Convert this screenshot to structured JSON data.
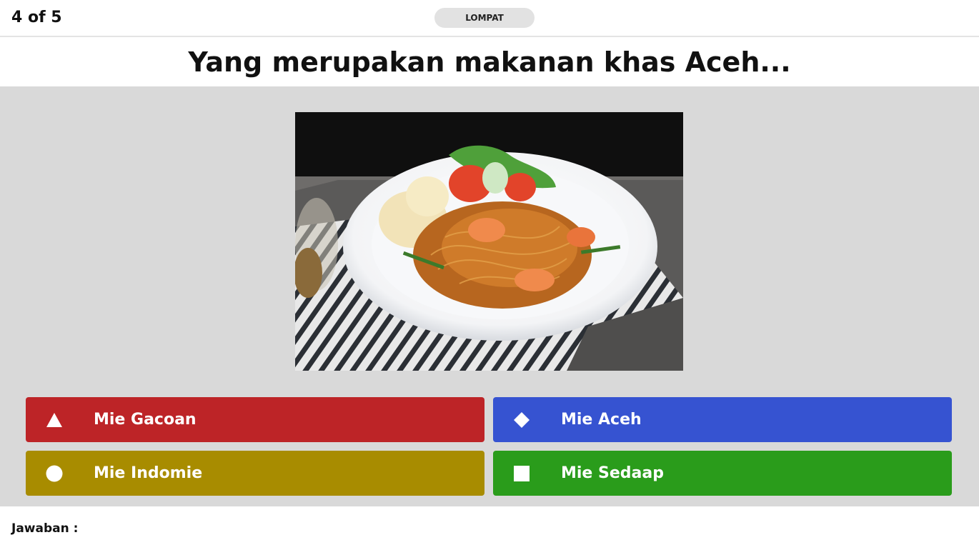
{
  "header": {
    "progress": "4 of 5",
    "skip_label": "LOMPAT"
  },
  "question": {
    "text": "Yang merupakan makanan khas Aceh..."
  },
  "answers": [
    {
      "label": "Mie Gacoan",
      "icon": "triangle-icon",
      "color": "#bd2427"
    },
    {
      "label": "Mie Aceh",
      "icon": "diamond-icon",
      "color": "#3653d1"
    },
    {
      "label": "Mie Indomie",
      "icon": "circle-icon",
      "color": "#a88c00"
    },
    {
      "label": "Mie Sedaap",
      "icon": "square-icon",
      "color": "#2a9c1b"
    }
  ],
  "footer": {
    "answer_caption": "Jawaban :"
  }
}
